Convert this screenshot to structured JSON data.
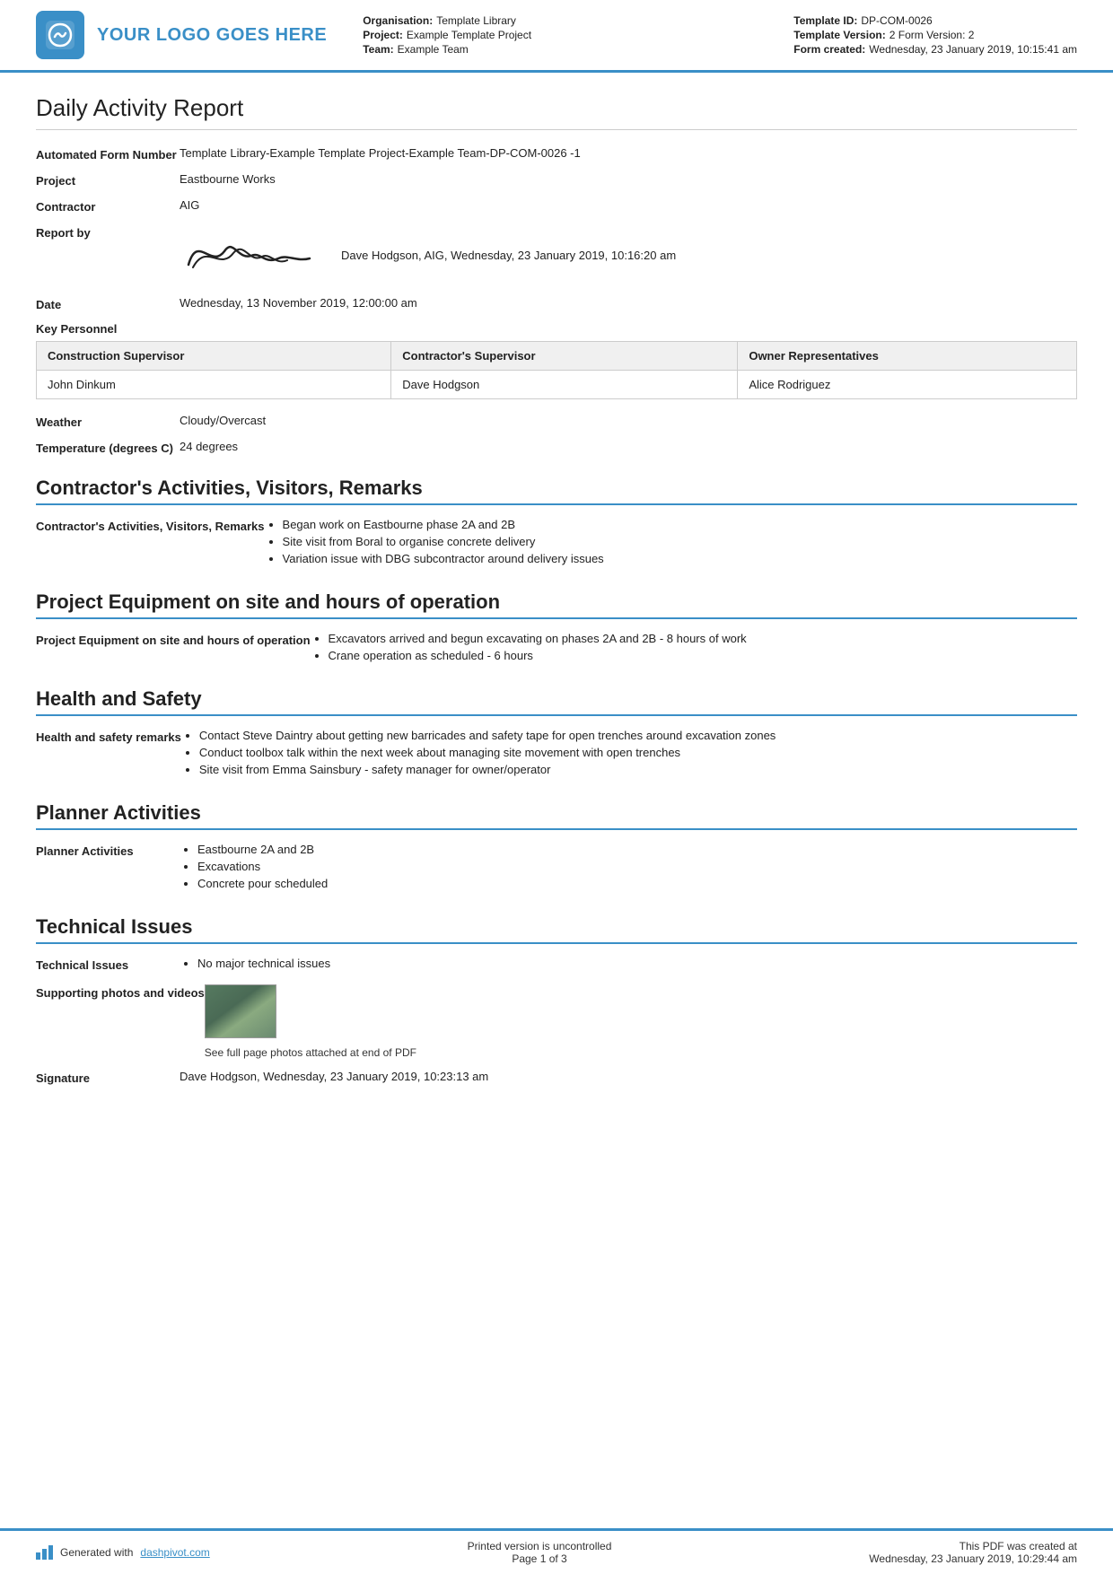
{
  "header": {
    "logo_text": "YOUR LOGO GOES HERE",
    "org_label": "Organisation:",
    "org_value": "Template Library",
    "project_label": "Project:",
    "project_value": "Example Template Project",
    "team_label": "Team:",
    "team_value": "Example Team",
    "template_id_label": "Template ID:",
    "template_id_value": "DP-COM-0026",
    "template_version_label": "Template Version:",
    "template_version_value": "2 Form Version: 2",
    "form_created_label": "Form created:",
    "form_created_value": "Wednesday, 23 January 2019, 10:15:41 am"
  },
  "report": {
    "title": "Daily Activity Report",
    "automated_form_label": "Automated Form Number",
    "automated_form_value": "Template Library-Example Template Project-Example Team-DP-COM-0026   -1",
    "project_label": "Project",
    "project_value": "Eastbourne Works",
    "contractor_label": "Contractor",
    "contractor_value": "AIG",
    "report_by_label": "Report by",
    "report_by_value": "Dave Hodgson, AIG, Wednesday, 23 January 2019, 10:16:20 am",
    "date_label": "Date",
    "date_value": "Wednesday, 13 November 2019, 12:00:00 am",
    "key_personnel_label": "Key Personnel",
    "weather_label": "Weather",
    "weather_value": "Cloudy/Overcast",
    "temperature_label": "Temperature (degrees C)",
    "temperature_value": "24 degrees"
  },
  "personnel_table": {
    "col1_header": "Construction Supervisor",
    "col2_header": "Contractor's Supervisor",
    "col3_header": "Owner Representatives",
    "col1_value": "John Dinkum",
    "col2_value": "Dave Hodgson",
    "col3_value": "Alice Rodriguez"
  },
  "contractors_activities": {
    "heading": "Contractor's Activities, Visitors, Remarks",
    "field_label": "Contractor's Activities, Visitors, Remarks",
    "items": [
      "Began work on Eastbourne phase 2A and 2B",
      "Site visit from Boral to organise concrete delivery",
      "Variation issue with DBG subcontractor around delivery issues"
    ]
  },
  "project_equipment": {
    "heading": "Project Equipment on site and hours of operation",
    "field_label": "Project Equipment on site and hours of operation",
    "items": [
      "Excavators arrived and begun excavating on phases 2A and 2B - 8 hours of work",
      "Crane operation as scheduled - 6 hours"
    ]
  },
  "health_safety": {
    "heading": "Health and Safety",
    "field_label": "Health and safety remarks",
    "items": [
      "Contact Steve Daintry about getting new barricades and safety tape for open trenches around excavation zones",
      "Conduct toolbox talk within the next week about managing site movement with open trenches",
      "Site visit from Emma Sainsbury - safety manager for owner/operator"
    ]
  },
  "planner_activities": {
    "heading": "Planner Activities",
    "field_label": "Planner Activities",
    "items": [
      "Eastbourne 2A and 2B",
      "Excavations",
      "Concrete pour scheduled"
    ]
  },
  "technical_issues": {
    "heading": "Technical Issues",
    "field_label": "Technical Issues",
    "items": [
      "No major technical issues"
    ],
    "photos_label": "Supporting photos and videos",
    "photo_caption": "See full page photos attached at end of PDF",
    "signature_label": "Signature",
    "signature_value": "Dave Hodgson, Wednesday, 23 January 2019, 10:23:13 am"
  },
  "footer": {
    "generated_text": "Generated with",
    "dashpivot_link": "dashpivot.com",
    "uncontrolled_text": "Printed version is uncontrolled",
    "page_text": "Page 1 of 3",
    "pdf_created_label": "This PDF was created at",
    "pdf_created_value": "Wednesday, 23 January 2019, 10:29:44 am"
  }
}
